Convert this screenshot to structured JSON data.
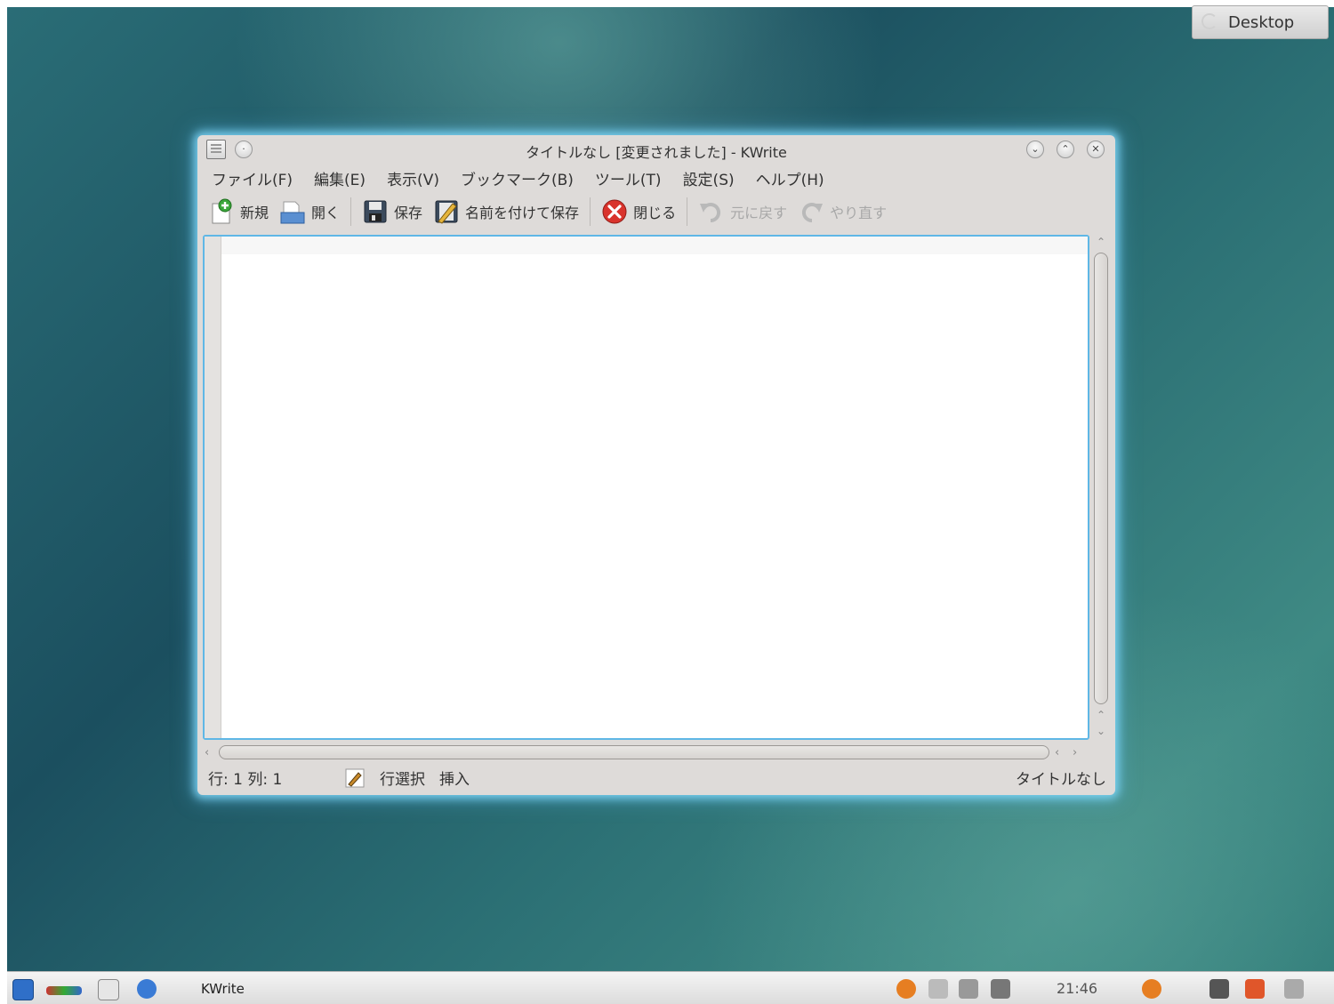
{
  "desktop": {
    "label": "Desktop"
  },
  "window": {
    "title": "タイトルなし [変更されました] - KWrite",
    "buttons": {
      "minimize": "⌄",
      "maximize": "⌃",
      "close": "✕"
    }
  },
  "menubar": {
    "items": [
      "ファイル(F)",
      "編集(E)",
      "表示(V)",
      "ブックマーク(B)",
      "ツール(T)",
      "設定(S)",
      "ヘルプ(H)"
    ]
  },
  "toolbar": {
    "new": "新規",
    "open": "開く",
    "save": "保存",
    "save_as": "名前を付けて保存",
    "close": "閉じる",
    "undo": "元に戻す",
    "redo": "やり直す"
  },
  "statusbar": {
    "position": "行: 1 列: 1",
    "select_mode": "行選択",
    "insert_mode": "挿入",
    "document_name": "タイトルなし"
  },
  "taskbar": {
    "task_label": "KWrite",
    "clock": "21:46"
  },
  "icons": [
    "app-icon",
    "new-document-icon",
    "open-folder-icon",
    "save-disk-icon",
    "save-as-icon",
    "close-red-icon",
    "undo-icon",
    "redo-icon",
    "edit-pencil-icon",
    "kde-menu-icon"
  ],
  "colors": {
    "focus_border": "#5fb7e6",
    "close_red": "#d9332c",
    "new_green": "#3aa63a"
  }
}
